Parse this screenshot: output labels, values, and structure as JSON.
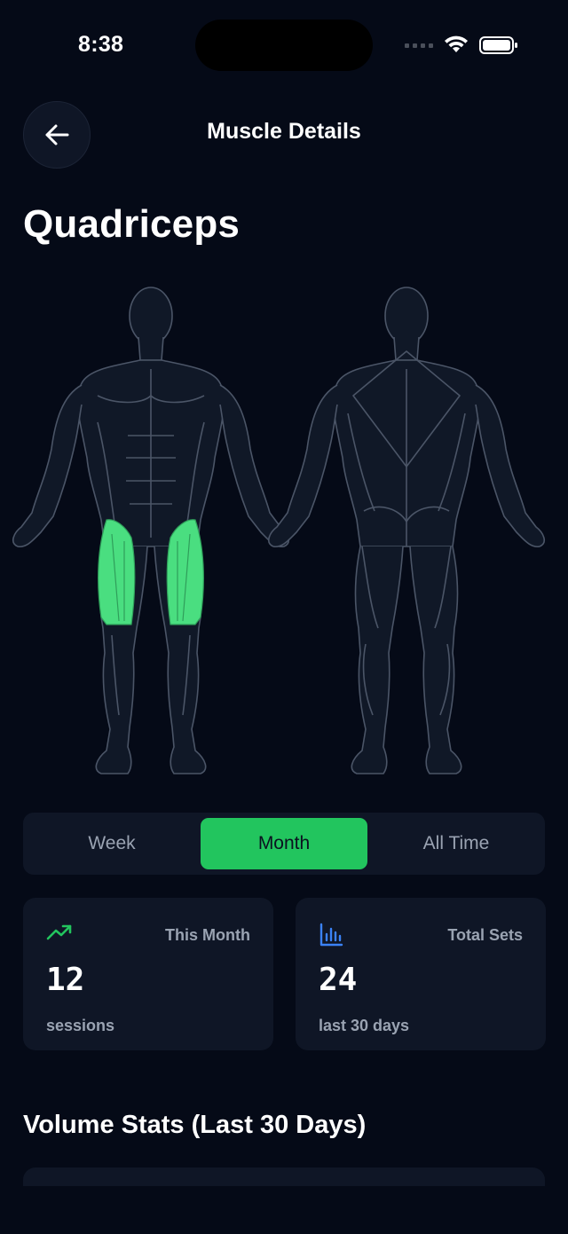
{
  "status_bar": {
    "time": "8:38"
  },
  "header": {
    "title": "Muscle Details"
  },
  "muscle": {
    "name": "Quadriceps"
  },
  "colors": {
    "accent": "#22c55e",
    "background": "#050a17",
    "card": "#0f1626",
    "muted": "#9aa3b2",
    "highlight_muscle": "#4ade80"
  },
  "icons": {
    "back": "arrow-left-icon",
    "trend": "trending-up-icon",
    "chart": "bar-chart-icon"
  },
  "period_tabs": [
    {
      "label": "Week",
      "active": false
    },
    {
      "label": "Month",
      "active": true
    },
    {
      "label": "All Time",
      "active": false
    }
  ],
  "stats": [
    {
      "label": "This Month",
      "value": "12",
      "sub": "sessions"
    },
    {
      "label": "Total Sets",
      "value": "24",
      "sub": "last 30 days"
    }
  ],
  "volume_section": {
    "title": "Volume Stats (Last 30 Days)"
  }
}
